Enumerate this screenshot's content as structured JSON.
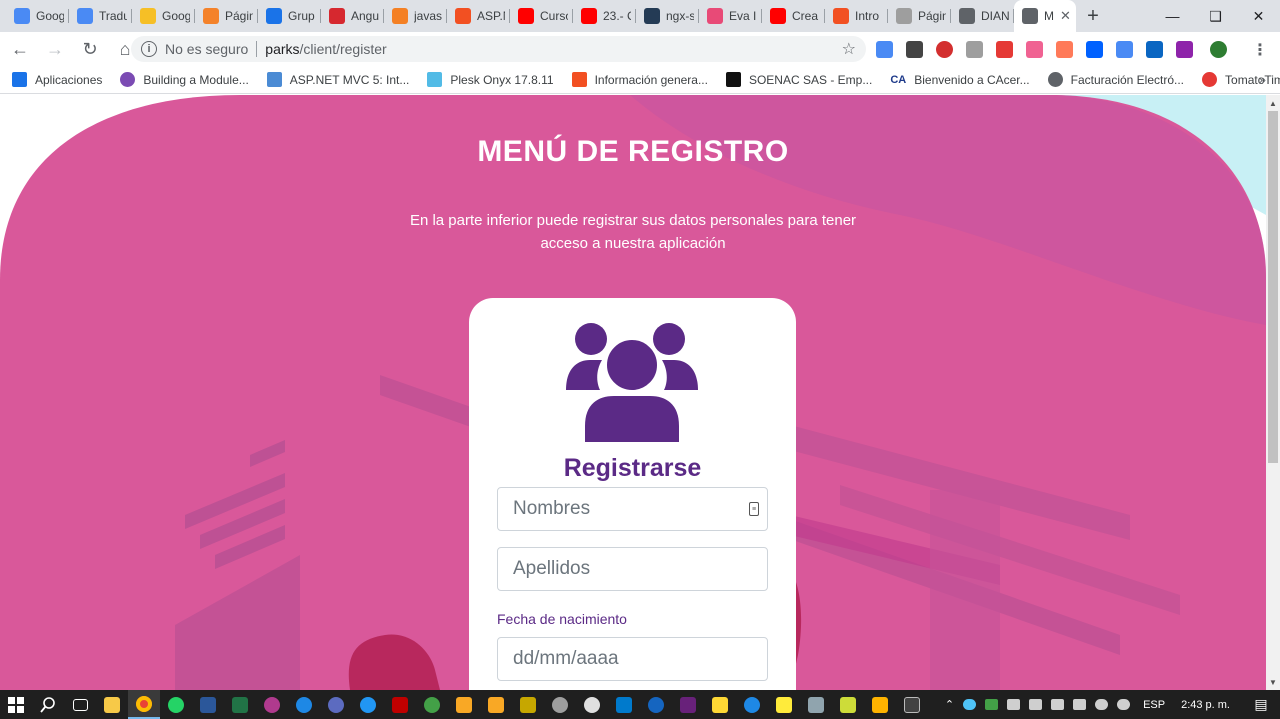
{
  "tabs": [
    {
      "title": "Goog",
      "icon": "google-translate-icon",
      "color": "#4a8af4"
    },
    {
      "title": "Tradu",
      "icon": "google-translate-icon",
      "color": "#4a8af4"
    },
    {
      "title": "Goog",
      "icon": "google-keep-icon",
      "color": "#f6bf26"
    },
    {
      "title": "Págin",
      "icon": "orange-d-icon",
      "color": "#f4822a"
    },
    {
      "title": "Grup",
      "icon": "loading-spinner-icon",
      "color": "#1a73e8"
    },
    {
      "title": "Angu",
      "icon": "angular-icon",
      "color": "#d6282f"
    },
    {
      "title": "javas",
      "icon": "stackoverflow-icon",
      "color": "#f48024"
    },
    {
      "title": "ASP.N",
      "icon": "microsoft-icon",
      "color": "#f25022"
    },
    {
      "title": "Curso",
      "icon": "youtube-icon",
      "color": "#ff0000"
    },
    {
      "title": "23.- C",
      "icon": "youtube-icon",
      "color": "#ff0000"
    },
    {
      "title": "ngx-s",
      "icon": "ngx-icon",
      "color": "#243b55"
    },
    {
      "title": "Eva I",
      "icon": "heart-icon",
      "color": "#e84a77"
    },
    {
      "title": "Crea",
      "icon": "youtube-icon",
      "color": "#ff0000"
    },
    {
      "title": "Intro",
      "icon": "microsoft-icon",
      "color": "#f25022"
    },
    {
      "title": "Págin",
      "icon": "dot-icon",
      "color": "#9e9e9e"
    },
    {
      "title": "DIAN",
      "icon": "globe-icon",
      "color": "#5f6368"
    },
    {
      "title": "M",
      "icon": "globe-icon",
      "color": "#5f6368",
      "active": true
    }
  ],
  "omnibox": {
    "security_text": "No es seguro",
    "host": "parks",
    "path": "/client/register"
  },
  "bookmarks": [
    {
      "label": "Aplicaciones",
      "icon": "apps-grid-icon",
      "color": "#1a73e8"
    },
    {
      "label": "Building a Module...",
      "icon": "circle-icon",
      "color": "#7b4bb3"
    },
    {
      "label": "ASP.NET MVC 5: Int...",
      "icon": "web-icon",
      "color": "#4b8bd4"
    },
    {
      "label": "Plesk Onyx 17.8.11",
      "icon": "plesk-icon",
      "color": "#52bbe6"
    },
    {
      "label": "Información genera...",
      "icon": "microsoft-icon",
      "color": "#f25022"
    },
    {
      "label": "SOENAC SAS - Emp...",
      "icon": "soenac-icon",
      "color": "#111111"
    },
    {
      "label": "Bienvenido a CAcer...",
      "icon": "ca-icon",
      "color": "#1e3a8a",
      "badge": "CA"
    },
    {
      "label": "Facturación Electró...",
      "icon": "globe-icon",
      "color": "#5f6368"
    },
    {
      "label": "TomatoTimer",
      "icon": "tomato-icon",
      "color": "#e53935"
    }
  ],
  "page": {
    "title": "MENÚ DE REGISTRO",
    "description": "En la parte inferior puede registrar sus datos personales para tener acceso a nuestra aplicación",
    "card_title": "Registrarse",
    "fields": {
      "nombres_placeholder": "Nombres",
      "apellidos_placeholder": "Apellidos",
      "fecha_label": "Fecha de nacimiento",
      "fecha_placeholder": "dd/mm/aaaa"
    },
    "colors": {
      "background": "#d9589a",
      "accent": "#5b2a86"
    }
  },
  "taskbar": {
    "language": "ESP",
    "clock": "2:43 p. m."
  }
}
